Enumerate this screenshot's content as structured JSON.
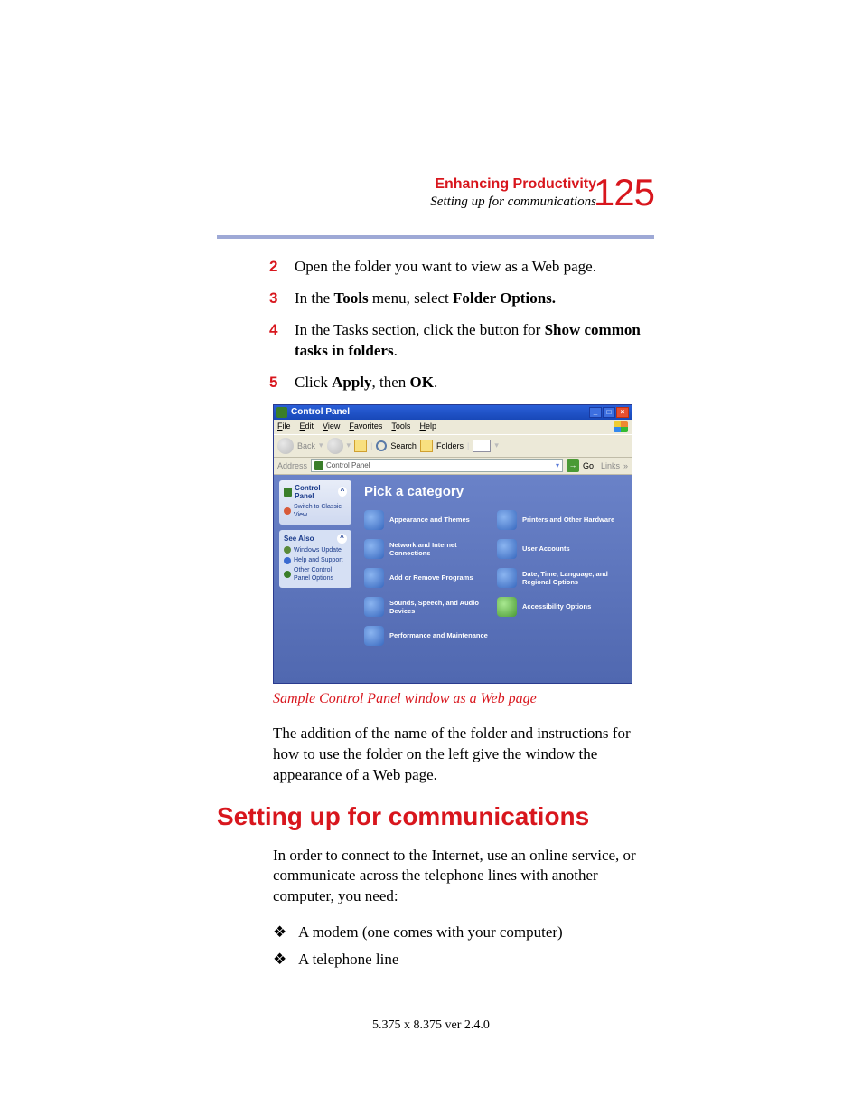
{
  "header": {
    "chapter": "Enhancing Productivity",
    "section": "Setting up for communications",
    "page_number": "125"
  },
  "steps": [
    {
      "num": "2",
      "pre": "Open the folder you want to view as a Web page.",
      "b1": "",
      "mid": "",
      "b2": "",
      "post": ""
    },
    {
      "num": "3",
      "pre": "In the ",
      "b1": "Tools",
      "mid": " menu, select ",
      "b2": "Folder Options.",
      "post": ""
    },
    {
      "num": "4",
      "pre": "In the Tasks section, click the button for ",
      "b1": "Show common tasks in folders",
      "mid": ".",
      "b2": "",
      "post": ""
    },
    {
      "num": "5",
      "pre": " Click ",
      "b1": "Apply",
      "mid": ", then ",
      "b2": "OK",
      "post": "."
    }
  ],
  "screenshot": {
    "title": "Control Panel",
    "menus": [
      "File",
      "Edit",
      "View",
      "Favorites",
      "Tools",
      "Help"
    ],
    "toolbar": {
      "back": "Back",
      "search": "Search",
      "folders": "Folders"
    },
    "address_label": "Address",
    "address_value": "Control Panel",
    "go": "Go",
    "links": "Links",
    "sidebar": {
      "box1_title": "Control Panel",
      "box1_link": "Switch to Classic View",
      "box2_title": "See Also",
      "box2_links": [
        "Windows Update",
        "Help and Support",
        "Other Control Panel Options"
      ]
    },
    "main_title": "Pick a category",
    "categories_left": [
      "Appearance and Themes",
      "Network and Internet Connections",
      "Add or Remove Programs",
      "Sounds, Speech, and Audio Devices",
      "Performance and Maintenance"
    ],
    "categories_right": [
      "Printers and Other Hardware",
      "User Accounts",
      "Date, Time, Language, and Regional Options",
      "Accessibility Options"
    ]
  },
  "caption": "Sample Control Panel window as a Web page",
  "para1": "The addition of the name of the folder and instructions for how to use the folder on the left give the window the appearance of a Web page.",
  "h2": "Setting up for communications",
  "para2": "In order to connect to the Internet, use an online service, or communicate across the telephone lines with another computer, you need:",
  "bullets": [
    "A modem (one comes with your computer)",
    "A telephone line"
  ],
  "footer": "5.375 x 8.375 ver 2.4.0"
}
